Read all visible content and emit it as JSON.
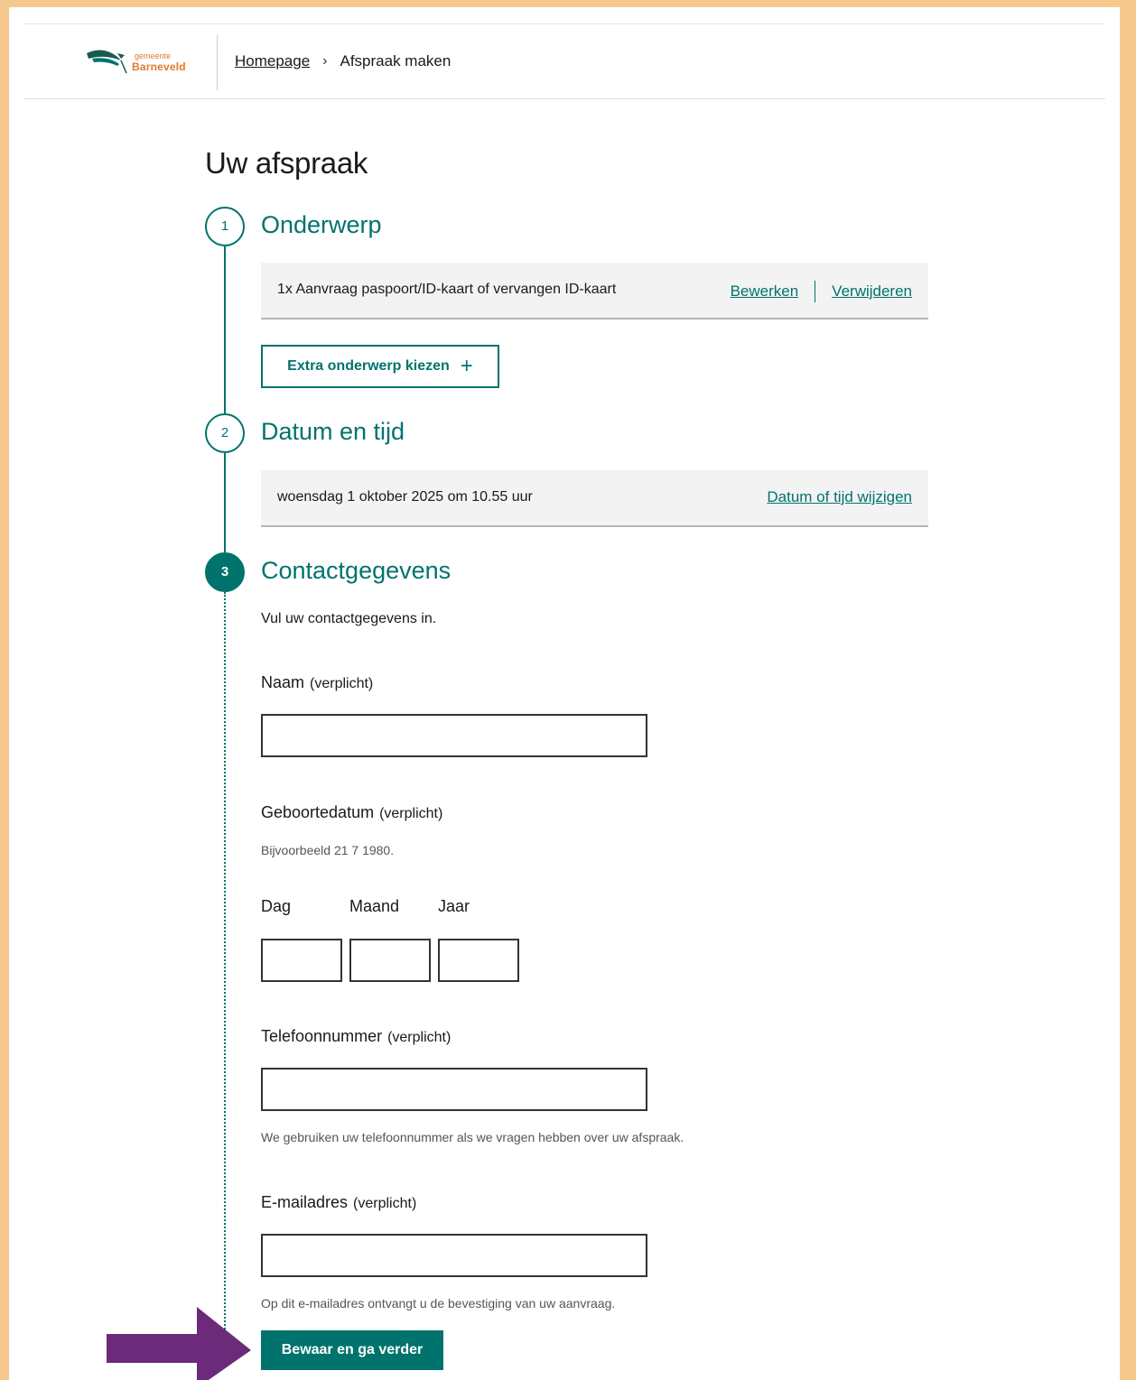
{
  "header": {
    "logo_small": "gemeente",
    "logo_big": "Barneveld",
    "breadcrumb_home": "Homepage",
    "breadcrumb_separator": "›",
    "breadcrumb_current": "Afspraak maken"
  },
  "page_title": "Uw afspraak",
  "steps": {
    "step1": {
      "number": "1",
      "title": "Onderwerp",
      "item_text": "1x Aanvraag paspoort/ID-kaart of vervangen ID-kaart",
      "edit_link": "Bewerken",
      "delete_link": "Verwijderen",
      "extra_button": "Extra onderwerp kiezen"
    },
    "step2": {
      "number": "2",
      "title": "Datum en tijd",
      "datetime_text": "woensdag 1 oktober 2025 om 10.55 uur",
      "change_link": "Datum of tijd wijzigen"
    },
    "step3": {
      "number": "3",
      "title": "Contactgegevens",
      "intro": "Vul uw contactgegevens in."
    }
  },
  "form": {
    "required_suffix": "(verplicht)",
    "name_label": "Naam",
    "name_value": "",
    "birthdate_label": "Geboortedatum",
    "birthdate_hint": "Bijvoorbeeld 21 7 1980.",
    "day_label": "Dag",
    "month_label": "Maand",
    "year_label": "Jaar",
    "day_value": "",
    "month_value": "",
    "year_value": "",
    "phone_label": "Telefoonnummer",
    "phone_value": "",
    "phone_hint": "We gebruiken uw telefoonnummer als we vragen hebben over uw afspraak.",
    "email_label": "E-mailadres",
    "email_value": "",
    "email_hint": "Op dit e-mailadres ontvangt u de bevestiging van uw aanvraag.",
    "submit_label": "Bewaar en ga verder"
  },
  "colors": {
    "accent": "#00736d",
    "frame": "#f5c98e",
    "arrow": "#6b2a7a",
    "logo": "#e07a2c"
  }
}
